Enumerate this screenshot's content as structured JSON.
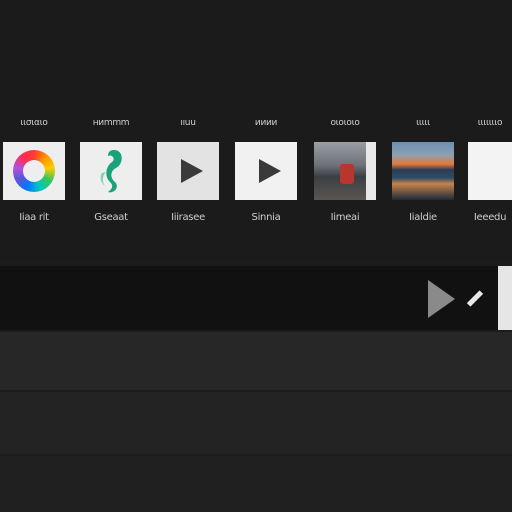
{
  "gallery": {
    "tiles": [
      {
        "header": "ιισιαιο",
        "label": "Iiaa rit",
        "icon": "color-wheel-icon"
      },
      {
        "header": "ниmmm",
        "label": "Gseaat",
        "icon": "seahorse-icon"
      },
      {
        "header": "ııuu",
        "label": "Iiirasee",
        "icon": "play-icon"
      },
      {
        "header": "ииии",
        "label": "Sinnia",
        "icon": "play-icon"
      },
      {
        "header": "οιοιοιο",
        "label": "Iimeai",
        "icon": "photo-icon"
      },
      {
        "header": "ιιιιι",
        "label": "Iialdie",
        "icon": "landscape-photo-icon"
      },
      {
        "header": "ιιιιιιιο",
        "label": "Ieeedu",
        "icon": "blank-thumbnail"
      }
    ]
  },
  "player": {
    "play_icon": "play-icon",
    "edit_icon": "pen-icon"
  },
  "colors": {
    "background": "#1c1c1c",
    "player_bar": "#111111",
    "accent_teal": "#1aa37a"
  }
}
